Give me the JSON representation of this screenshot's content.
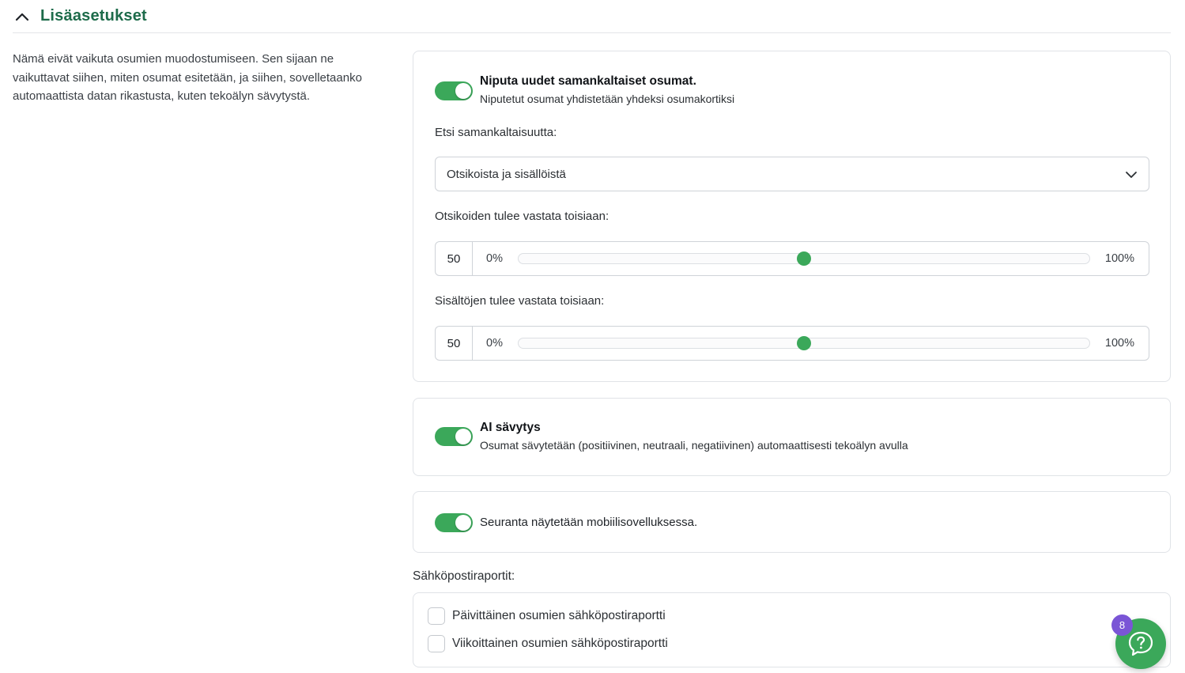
{
  "section": {
    "title": "Lisäasetukset",
    "description": "Nämä eivät vaikuta osumien muodostumiseen. Sen sijaan ne vaikuttavat siihen, miten osumat esitetään, ja siihen, sovelletaanko automaattista datan rikastusta, kuten tekoälyn sävytystä."
  },
  "grouping": {
    "enabled": true,
    "title": "Niputa uudet samankaltaiset osumat.",
    "subtitle": "Niputetut osumat yhdistetään yhdeksi osumakortiksi",
    "similarity_label": "Etsi samankaltaisuutta:",
    "similarity_value": "Otsikoista ja sisällöistä",
    "title_match_label": "Otsikoiden tulee vastata toisiaan:",
    "title_match_value": "50",
    "title_match_percent": 50,
    "content_match_label": "Sisältöjen tulee vastata toisiaan:",
    "content_match_value": "50",
    "content_match_percent": 50,
    "slider_min": "0%",
    "slider_max": "100%"
  },
  "ai_tone": {
    "enabled": true,
    "title": "AI sävytys",
    "subtitle": "Osumat sävytetään (positiivinen, neutraali, negatiivinen) automaattisesti tekoälyn avulla"
  },
  "mobile": {
    "enabled": true,
    "label": "Seuranta näytetään mobiilisovelluksessa."
  },
  "email_reports": {
    "heading": "Sähköpostiraportit:",
    "options": [
      {
        "label": "Päivittäinen osumien sähköpostiraportti",
        "checked": false
      },
      {
        "label": "Viikoittainen osumien sähköpostiraportti",
        "checked": false
      }
    ]
  },
  "help": {
    "badge": "8",
    "icon": "question-icon"
  },
  "colors": {
    "accent": "#3ba85a",
    "title": "#1d6b4a",
    "badge": "#7a55d6"
  }
}
